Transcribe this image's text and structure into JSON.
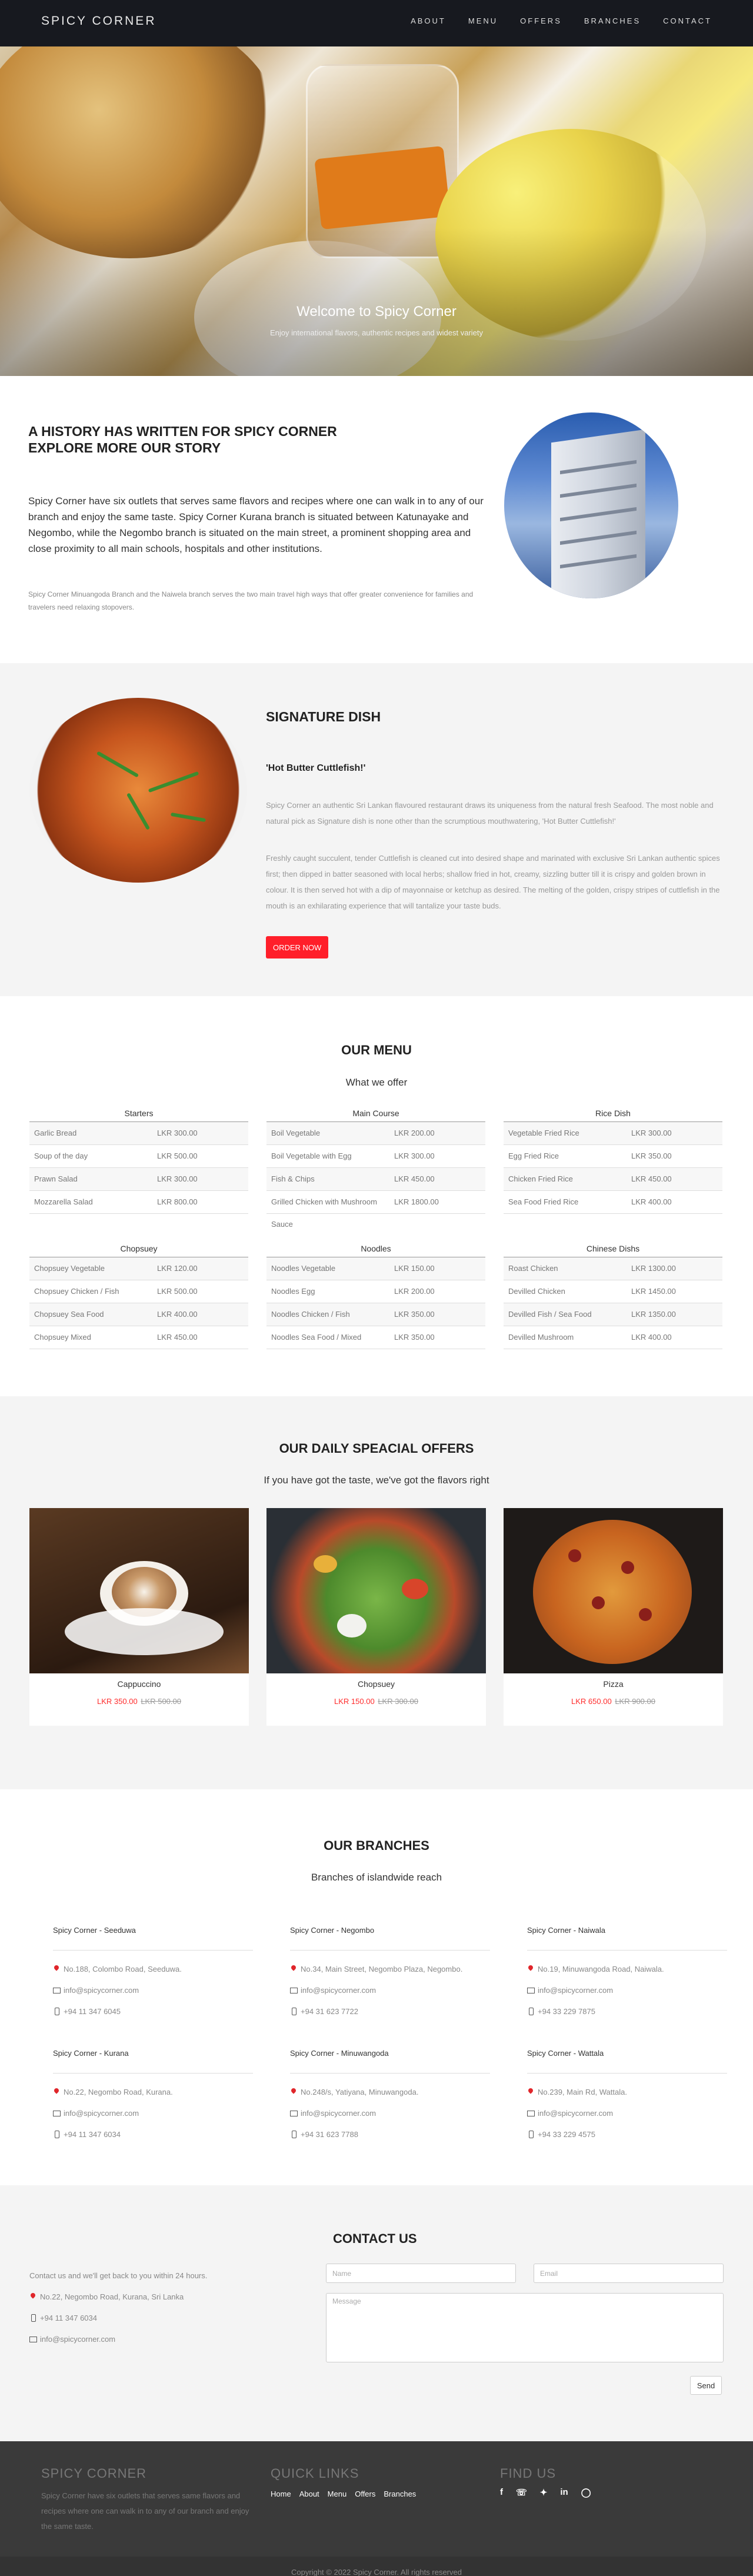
{
  "nav": {
    "brand": "SPICY CORNER",
    "links": [
      "ABOUT",
      "MENU",
      "OFFERS",
      "BRANCHES",
      "CONTACT"
    ]
  },
  "hero": {
    "title": "Welcome to Spicy Corner",
    "subtitle": "Enjoy international flavors, authentic recipes and widest variety"
  },
  "history": {
    "heading": "A HISTORY HAS WRITTEN FOR SPICY CORNER EXPLORE MORE OUR STORY",
    "lead": "Spicy Corner have six outlets that serves same flavors and recipes where one can walk in to any of our branch and enjoy the same taste. Spicy Corner Kurana branch is situated between Katunayake and Negombo, while the Negombo branch is situated on the main street, a prominent shopping area and close proximity to all main schools, hospitals and other institutions.",
    "small": "Spicy Corner Minuangoda Branch and the Naiwela branch serves the two main travel high ways that offer greater convenience for families and travelers need relaxing stopovers."
  },
  "signature": {
    "heading": "SIGNATURE DISH",
    "dish_name": "'Hot Butter Cuttlefish!'",
    "para1": "Spicy Corner an authentic Sri Lankan flavoured restaurant draws its uniqueness from the natural fresh Seafood. The most noble and natural pick as Signature dish is none other than the scrumptious mouthwatering, 'Hot Butter Cuttlefish!'",
    "para2": "Freshly caught succulent, tender Cuttlefish is cleaned cut into desired shape and marinated with exclusive Sri Lankan authentic spices first; then dipped in batter seasoned with local herbs; shallow fried in hot, creamy, sizzling butter till it is crispy and golden brown in colour. It is then served hot with a dip of mayonnaise or ketchup as desired. The melting of the golden, crispy stripes of cuttlefish in the mouth is an exhilarating experience that will tantalize your taste buds.",
    "button": "ORDER NOW"
  },
  "menu": {
    "heading": "OUR MENU",
    "subheading": "What we offer",
    "categories": [
      {
        "title": "Starters",
        "items": [
          [
            "Garlic Bread",
            "LKR 300.00"
          ],
          [
            "Soup of the day",
            "LKR 500.00"
          ],
          [
            "Prawn Salad",
            "LKR 300.00"
          ],
          [
            "Mozzarella Salad",
            "LKR 800.00"
          ]
        ]
      },
      {
        "title": "Main Course",
        "items": [
          [
            "Boil Vegetable",
            "LKR 200.00"
          ],
          [
            "Boil Vegetable with Egg",
            "LKR 300.00"
          ],
          [
            "Fish & Chips",
            "LKR 450.00"
          ],
          [
            "Grilled Chicken with Mushroom Sauce",
            "LKR 1800.00"
          ]
        ]
      },
      {
        "title": "Rice Dish",
        "items": [
          [
            "Vegetable Fried Rice",
            "LKR 300.00"
          ],
          [
            "Egg Fried Rice",
            "LKR 350.00"
          ],
          [
            "Chicken Fried Rice",
            "LKR 450.00"
          ],
          [
            "Sea Food Fried Rice",
            "LKR 400.00"
          ]
        ]
      },
      {
        "title": "Chopsuey",
        "items": [
          [
            "Chopsuey Vegetable",
            "LKR 120.00"
          ],
          [
            "Chopsuey Chicken / Fish",
            "LKR 500.00"
          ],
          [
            "Chopsuey Sea Food",
            "LKR 400.00"
          ],
          [
            "Chopsuey Mixed",
            "LKR 450.00"
          ]
        ]
      },
      {
        "title": "Noodles",
        "items": [
          [
            "Noodles Vegetable",
            "LKR 150.00"
          ],
          [
            "Noodles Egg",
            "LKR 200.00"
          ],
          [
            "Noodles Chicken / Fish",
            "LKR 350.00"
          ],
          [
            "Noodles Sea Food / Mixed",
            "LKR 350.00"
          ]
        ]
      },
      {
        "title": "Chinese Dishs",
        "items": [
          [
            "Roast Chicken",
            "LKR 1300.00"
          ],
          [
            "Devilled Chicken",
            "LKR 1450.00"
          ],
          [
            "Devilled Fish / Sea Food",
            "LKR 1350.00"
          ],
          [
            "Devilled Mushroom",
            "LKR 400.00"
          ]
        ]
      }
    ]
  },
  "offers": {
    "heading": "OUR DAILY SPEACIAL OFFERS",
    "subheading": "If you have got the taste, we've got the flavors right",
    "items": [
      {
        "name": "Cappuccino",
        "price": "LKR 350.00",
        "old": "LKR 500.00"
      },
      {
        "name": "Chopsuey",
        "price": "LKR 150.00",
        "old": "LKR 300.00"
      },
      {
        "name": "Pizza",
        "price": "LKR 650.00",
        "old": "LKR 900.00"
      }
    ]
  },
  "branches": {
    "heading": "OUR BRANCHES",
    "subheading": "Branches of islandwide reach",
    "items": [
      {
        "name": "Spicy Corner - Seeduwa",
        "address": "No.188, Colombo Road, Seeduwa.",
        "email": "info@spicycorner.com",
        "phone": "+94 11 347 6045"
      },
      {
        "name": "Spicy Corner - Negombo",
        "address": "No.34, Main Street, Negombo Plaza, Negombo.",
        "email": "info@spicycorner.com",
        "phone": "+94 31 623 7722"
      },
      {
        "name": "Spicy Corner - Naiwala",
        "address": "No.19, Minuwangoda Road, Naiwala.",
        "email": "info@spicycorner.com",
        "phone": "+94 33 229 7875"
      },
      {
        "name": "Spicy Corner - Kurana",
        "address": "No.22, Negombo Road, Kurana.",
        "email": "info@spicycorner.com",
        "phone": "+94 11 347 6034"
      },
      {
        "name": "Spicy Corner - Minuwangoda",
        "address": "No.248/s, Yatiyana, Minuwangoda.",
        "email": "info@spicycorner.com",
        "phone": "+94 31 623 7788"
      },
      {
        "name": "Spicy Corner - Wattala",
        "address": "No.239, Main Rd, Wattala.",
        "email": "info@spicycorner.com",
        "phone": "+94 33 229 4575"
      }
    ]
  },
  "contact": {
    "heading": "CONTACT US",
    "intro": "Contact us and we'll get back to you within 24 hours.",
    "address": "No.22, Negombo Road, Kurana, Sri Lanka",
    "phone": "+94 11 347 6034",
    "email": "info@spicycorner.com",
    "name_placeholder": "Name",
    "email_placeholder": "Email",
    "message_placeholder": "Message",
    "send": "Send"
  },
  "footer": {
    "brand": "SPICY CORNER",
    "about": "Spicy Corner have six outlets that serves same flavors and recipes where one can walk in to any of our branch and enjoy the same taste.",
    "quick_links_title": "QUICK LINKS",
    "quick_links": [
      "Home",
      "About",
      "Menu",
      "Offers",
      "Branches"
    ],
    "find_us_title": "FIND US",
    "social_icons": [
      "facebook-icon",
      "whatsapp-icon",
      "twitter-icon",
      "linkedin-icon",
      "instagram-icon"
    ],
    "copyright": "Copyright © 2022 Spicy Corner. All rights reserved"
  }
}
